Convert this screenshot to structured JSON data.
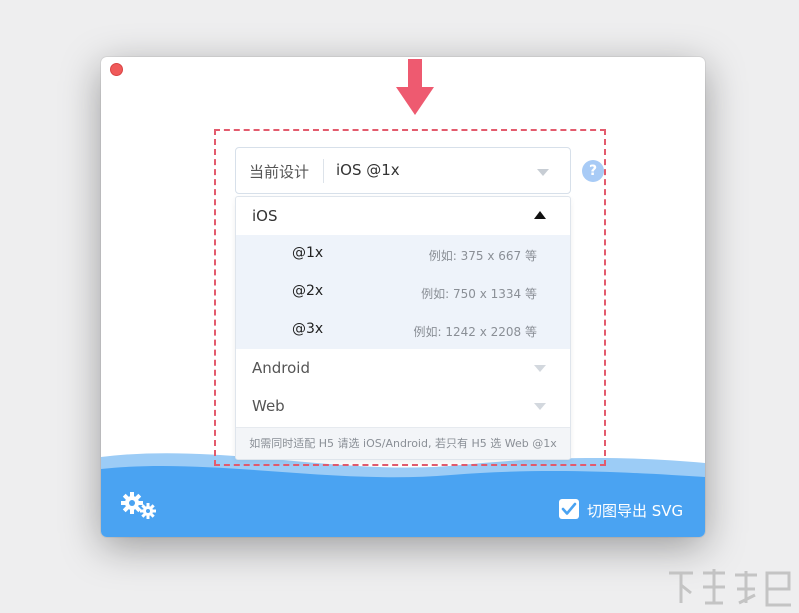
{
  "colors": {
    "accent_blue": "#4aa3f2",
    "dashed_red": "#e35b6d",
    "arrow_pink": "#ee5a70",
    "close_red": "#f05a5a"
  },
  "design_select": {
    "label": "当前设计",
    "value": "iOS @1x",
    "help_symbol": "?"
  },
  "dropdown": {
    "groups": [
      {
        "name": "iOS",
        "expanded": true,
        "items": [
          {
            "label": "@1x",
            "example": "例如: 375 x 667 等"
          },
          {
            "label": "@2x",
            "example": "例如: 750 x 1334 等"
          },
          {
            "label": "@3x",
            "example": "例如: 1242 x 2208 等"
          }
        ]
      },
      {
        "name": "Android",
        "expanded": false
      },
      {
        "name": "Web",
        "expanded": false
      }
    ],
    "note": "如需同时适配 H5 请选 iOS/Android, 若只有 H5 选 Web @1x"
  },
  "footer": {
    "export_checkbox_checked": true,
    "export_label": "切图导出 SVG"
  },
  "icons": {
    "close": "close-icon",
    "arrow": "arrow-down-icon",
    "help": "help-icon",
    "settings": "gear-icon",
    "check": "check-icon"
  }
}
